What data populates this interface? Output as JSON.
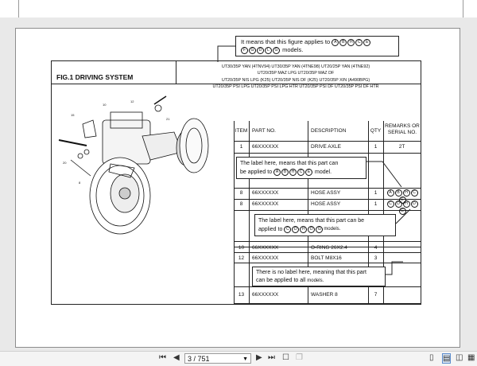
{
  "figure": {
    "title": "FIG.1  DRIVING SYSTEM",
    "models_line1": "UT30/35P YAN (4TNV94)   UT30/35P YAN (4TNE98)   UT20/25P YAN (4TNE92)",
    "models_line2": "UT20/35P MAZ LPG   UT20/35P MAZ DF",
    "models_line3": "UT20/35P NIS LPG (K25)   UT20/35P NIS DF (K25)   UT20/35P XIN (A490BPG)",
    "models_line4": "UT20/35P PSI LPG   UT20/35P PSI LPG HTR   UT20/35P PSI DF   UT20/35P PSI DF HTR",
    "top_callout_line1": "It means that this figure applies to",
    "top_callout_line2": "models."
  },
  "table": {
    "headers": [
      "ITEM",
      "PART NO.",
      "DESCRIPTION",
      "QTY",
      "REMARKS OR SERIAL NO."
    ],
    "rows": [
      {
        "item": "1",
        "part": "66XXXXXX",
        "desc": "DRIVE AXLE",
        "qty": "1",
        "remarks": "2T"
      },
      {
        "item": "8",
        "part": "66XXXXXX",
        "desc": "HOSE ASSY",
        "qty": "1",
        "remarks": ""
      },
      {
        "item": "8",
        "part": "66XXXXXX",
        "desc": "HOSE ASSY",
        "qty": "1",
        "remarks": ""
      },
      {
        "item": "10",
        "part": "66XXXXXX",
        "desc": "O-RING 26X2.4",
        "qty": "4",
        "remarks": ""
      },
      {
        "item": "12",
        "part": "66XXXXXX",
        "desc": "BOLT M8X16",
        "qty": "3",
        "remarks": ""
      },
      {
        "item": "13",
        "part": "66XXXXXX",
        "desc": "WASHER 8",
        "qty": "7",
        "remarks": ""
      }
    ]
  },
  "callouts": {
    "label1_a": "The label here,  means that this part can",
    "label1_b": "be applied to",
    "label1_c": "model.",
    "label2_a": "The label here,  means that this part can be",
    "label2_b": "applied to",
    "label2_c": "models.",
    "label3_a": "There is no label here,  meaning that this part",
    "label3_b": "can be applied to all",
    "label3_c": "models."
  },
  "circles": {
    "set1": [
      "A",
      "B",
      "H",
      "C",
      "E"
    ],
    "set1b": [
      "F",
      "G",
      "D",
      "L",
      "G"
    ],
    "set2": [
      "A",
      "B",
      "H",
      "C",
      "E"
    ],
    "set3": [
      "C",
      "D",
      "H",
      "D",
      "G"
    ]
  },
  "viewer": {
    "page_current": "3 / 751"
  }
}
